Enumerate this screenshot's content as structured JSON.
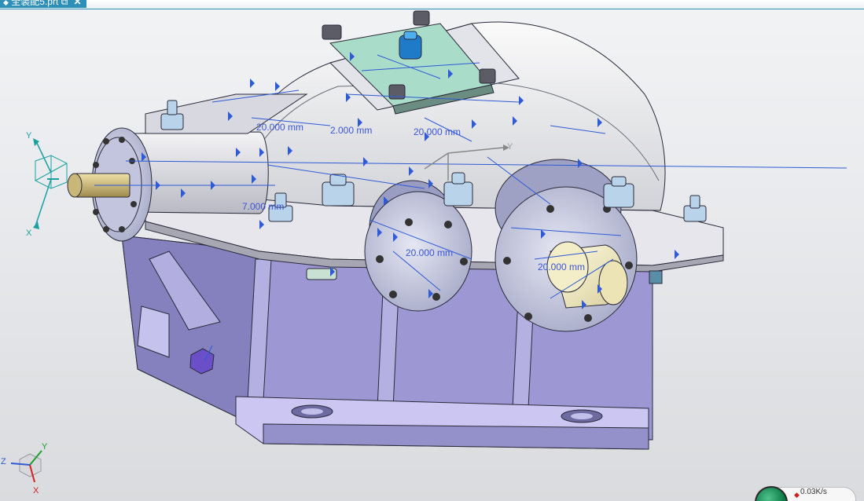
{
  "window": {
    "tab_title": "全装配5.prt",
    "tab_icon": "part-file-icon",
    "tab_close_glyph": "✕"
  },
  "viewport": {
    "dimensions": [
      {
        "id": "d1",
        "text": "20.000 mm"
      },
      {
        "id": "d2",
        "text": "2.000 mm"
      },
      {
        "id": "d3",
        "text": "20.000 mm"
      },
      {
        "id": "d4",
        "text": "7.000 mm"
      },
      {
        "id": "d5",
        "text": "20.000 mm"
      },
      {
        "id": "d6",
        "text": "20.000 mm"
      }
    ],
    "csys_label": "Y",
    "triad_left": {
      "y": "Y",
      "x": "X"
    },
    "view_triad": {
      "y": "Y",
      "z": "Z",
      "x": "X"
    }
  },
  "status": {
    "speed": "0.03K/s"
  },
  "colors": {
    "tab_accent": "#2e8fb8",
    "constraint_blue": "#2f5bd6",
    "housing_lavender": "#a7a2d8",
    "cover_green": "#a9dcc9"
  }
}
